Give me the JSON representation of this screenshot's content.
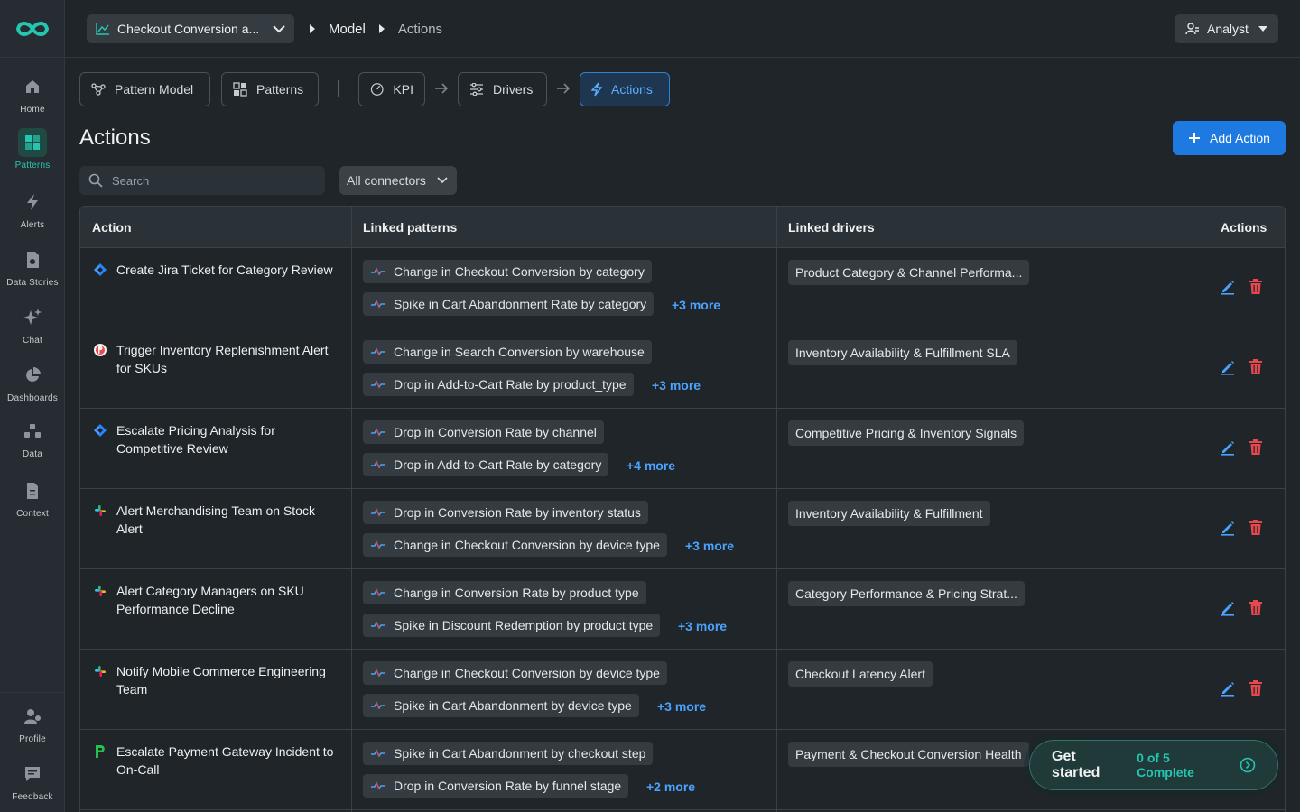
{
  "sidebar": {
    "items": [
      {
        "label": "Home",
        "icon": "home-icon"
      },
      {
        "label": "Patterns",
        "icon": "patterns-icon",
        "active": true
      },
      {
        "label": "Alerts",
        "icon": "lightning-icon"
      },
      {
        "label": "Data Stories",
        "icon": "data-stories-icon"
      },
      {
        "label": "Chat",
        "icon": "sparkle-icon"
      },
      {
        "label": "Dashboards",
        "icon": "pie-chart-icon"
      },
      {
        "label": "Data",
        "icon": "data-icon"
      },
      {
        "label": "Context",
        "icon": "document-icon"
      }
    ],
    "bottom": [
      {
        "label": "Profile",
        "icon": "profile-icon"
      },
      {
        "label": "Feedback",
        "icon": "feedback-icon"
      }
    ]
  },
  "topbar": {
    "project": "Checkout Conversion a...",
    "breadcrumb": [
      "Model",
      "Actions"
    ],
    "role": "Analyst"
  },
  "tabs": {
    "pattern_model": "Pattern Model",
    "patterns": "Patterns",
    "kpi": "KPI",
    "drivers": "Drivers",
    "actions": "Actions"
  },
  "page": {
    "title": "Actions",
    "add_button": "Add Action",
    "search_placeholder": "Search",
    "connector_filter": "All connectors"
  },
  "table": {
    "headers": [
      "Action",
      "Linked patterns",
      "Linked drivers",
      "Actions"
    ],
    "rows": [
      {
        "connector": "jira",
        "name": "Create Jira Ticket for Category Review",
        "patterns": [
          "Change in Checkout Conversion by category",
          "Spike in Cart Abandonment Rate by category"
        ],
        "more": "+3 more",
        "driver": "Product Category & Channel Performa..."
      },
      {
        "connector": "pagerduty",
        "name": "Trigger Inventory Replenishment Alert for SKUs",
        "patterns": [
          "Change in Search Conversion by warehouse",
          "Drop in Add-to-Cart Rate by product_type"
        ],
        "more": "+3 more",
        "driver": "Inventory Availability & Fulfillment SLA"
      },
      {
        "connector": "jira",
        "name": "Escalate Pricing Analysis for Competitive Review",
        "patterns": [
          "Drop in Conversion Rate by channel",
          "Drop in Add-to-Cart Rate by category"
        ],
        "more": "+4 more",
        "driver": "Competitive Pricing & Inventory Signals"
      },
      {
        "connector": "slack",
        "name": "Alert Merchandising Team on Stock Alert",
        "patterns": [
          "Drop in Conversion Rate by inventory status",
          "Change in Checkout Conversion by device type"
        ],
        "more": "+3 more",
        "driver": "Inventory Availability & Fulfillment"
      },
      {
        "connector": "slack",
        "name": "Alert Category Managers on SKU Performance Decline",
        "patterns": [
          "Change in Conversion Rate by product type",
          "Spike in Discount Redemption by product type"
        ],
        "more": "+3 more",
        "driver": "Category Performance & Pricing Strat..."
      },
      {
        "connector": "slack",
        "name": "Notify Mobile Commerce Engineering Team",
        "patterns": [
          "Change in Checkout Conversion by device type",
          "Spike in Cart Abandonment by device type"
        ],
        "more": "+3 more",
        "driver": "Checkout Latency Alert"
      },
      {
        "connector": "pagerduty-p",
        "name": "Escalate Payment Gateway Incident to On-Call",
        "patterns": [
          "Spike in Cart Abandonment by checkout step",
          "Drop in Conversion Rate by funnel stage"
        ],
        "more": "+2 more",
        "driver": "Payment & Checkout Conversion Health"
      }
    ]
  },
  "get_started": {
    "title": "Get started",
    "progress": "0 of 5 Complete"
  },
  "colors": {
    "accent": "#26c5b2",
    "primary": "#1e7ae0",
    "link": "#4aa3ff",
    "danger": "#e5484d",
    "edit": "#4aa3ff"
  }
}
